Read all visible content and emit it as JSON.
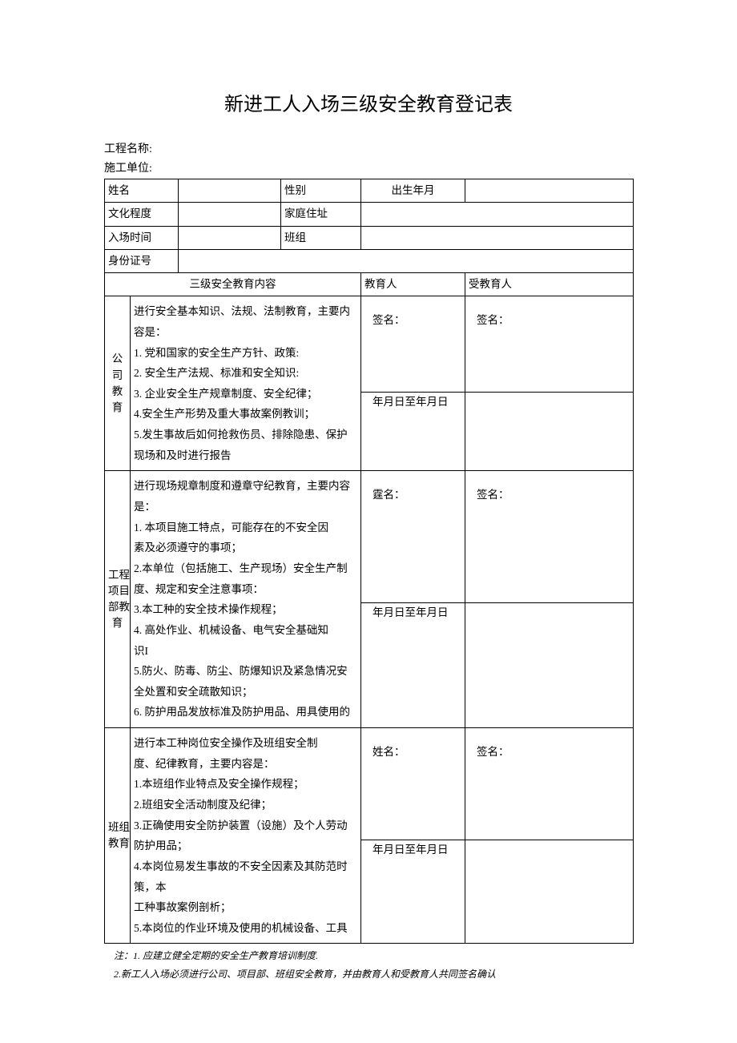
{
  "title": "新进工人入场三级安全教育登记表",
  "meta": {
    "projectNameLabel": "工程名称:",
    "constructionUnitLabel": "施工单位:"
  },
  "head": {
    "nameLabel": "姓名",
    "genderLabel": "性别",
    "birthLabel": "出生年月",
    "eduLabel": "文化程度",
    "homeAddrLabel": "家庭住址",
    "enterDateLabel": "入场时间",
    "teamLabel": "班组",
    "idLabel": "身份证号"
  },
  "cols": {
    "contentHeader": "三级安全教育内容",
    "educatorHeader": "教育人",
    "traineeHeader": "受教育人"
  },
  "sections": {
    "company": {
      "catLine1": "公司",
      "catLine2": "教育",
      "content": [
        "进行安全基本知识、法规、法制教育，主要内",
        "容是：",
        "1. 党和国家的安全生产方针、政策:",
        "2. 安全生产法规、标准和安全知识:",
        "3. 企业安全生产规章制度、安全纪律；",
        "4.安全生产形势及重大事故案例教训；",
        "5.发生事故后如何抢救伤员、排除隐患、保护",
        "现场和及时进行报告"
      ],
      "sig1": "签名：",
      "sig2": "签名：",
      "date": "年月日至年月日"
    },
    "project": {
      "catLine1": "工程",
      "catLine2": "项目",
      "catLine3": "部教",
      "catLine4": "育",
      "content": [
        "进行现场规章制度和遵章守纪教育，主要内容",
        "是：",
        "1. 本项目施工特点，可能存在的不安全因",
        "素及必须遵守的事项；",
        "2.本单位（包括施工、生产现场）安全生产制",
        "度、规定和安全注意事项：",
        "3.本工种的安全技术操作规程；",
        "4. 高处作业、机械设备、电气安全基础知",
        "识I",
        "5.防火、防毒、防尘、防爆知识及紧急情况安",
        "全处置和安全疏散知识；",
        "6. 防护用品发放标准及防护用品、用具使用的"
      ],
      "sig1": "霆名：",
      "sig2": "签名：",
      "date": "年月日至年月日"
    },
    "team": {
      "catLine1": "班组",
      "catLine2": "教育",
      "content": [
        "进行本工种岗位安全操作及班组安全制",
        "度、纪律教育，主要内容是：",
        "1.本班组作业特点及安全操作规程；",
        "2.班组安全活动制度及纪律；",
        "3.正确使用安全防护装置（设施）及个人劳动",
        "防护用品；",
        "4.本岗位易发生事故的不安全因素及其防范时",
        "策，本",
        "工种事故案例剖析；",
        "5.本岗位的作业环境及使用的机械设备、工具"
      ],
      "sig1": "姓名：",
      "sig2": "签名：",
      "date": "年月日至年月日"
    }
  },
  "notes": {
    "n1": "注：1. 应建立健全定期的安全生产教育培训制度.",
    "n2": "2.新工人入场必须进行公司、项目部、班组安全教育，并由教育人和受教育人共同签名确认"
  }
}
